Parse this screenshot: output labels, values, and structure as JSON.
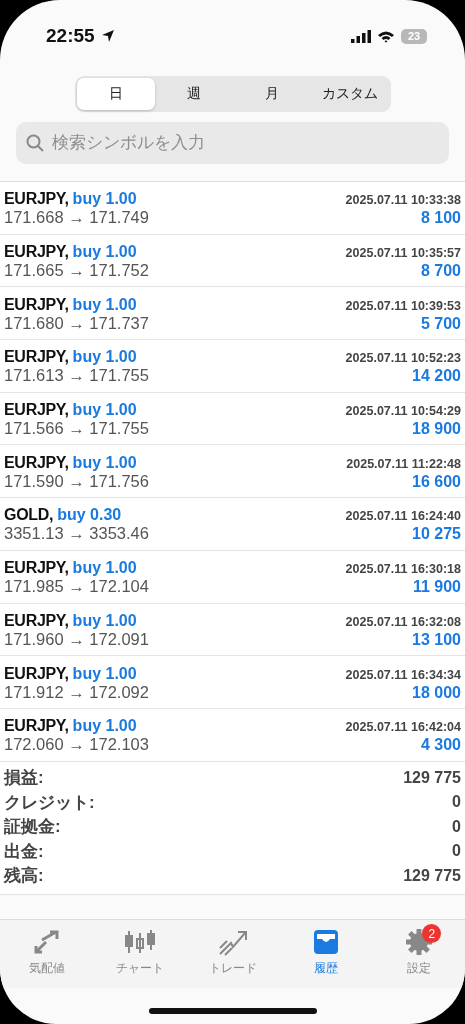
{
  "status_bar": {
    "time": "22:55",
    "battery": "23"
  },
  "period_tabs": [
    {
      "label": "日",
      "selected": true
    },
    {
      "label": "週",
      "selected": false
    },
    {
      "label": "月",
      "selected": false
    },
    {
      "label": "カスタム",
      "selected": false
    }
  ],
  "search": {
    "placeholder": "検索シンボルを入力"
  },
  "deals": [
    {
      "symbol": "EURJPY,",
      "side": "buy 1.00",
      "time": "2025.07.11 10:33:38",
      "prices": "171.668 → 171.749",
      "profit": "8 100"
    },
    {
      "symbol": "EURJPY,",
      "side": "buy 1.00",
      "time": "2025.07.11 10:35:57",
      "prices": "171.665 → 171.752",
      "profit": "8 700"
    },
    {
      "symbol": "EURJPY,",
      "side": "buy 1.00",
      "time": "2025.07.11 10:39:53",
      "prices": "171.680 → 171.737",
      "profit": "5 700"
    },
    {
      "symbol": "EURJPY,",
      "side": "buy 1.00",
      "time": "2025.07.11 10:52:23",
      "prices": "171.613 → 171.755",
      "profit": "14 200"
    },
    {
      "symbol": "EURJPY,",
      "side": "buy 1.00",
      "time": "2025.07.11 10:54:29",
      "prices": "171.566 → 171.755",
      "profit": "18 900"
    },
    {
      "symbol": "EURJPY,",
      "side": "buy 1.00",
      "time": "2025.07.11 11:22:48",
      "prices": "171.590 → 171.756",
      "profit": "16 600"
    },
    {
      "symbol": "GOLD,",
      "side": "buy 0.30",
      "time": "2025.07.11 16:24:40",
      "prices": "3351.13 → 3353.46",
      "profit": "10 275"
    },
    {
      "symbol": "EURJPY,",
      "side": "buy 1.00",
      "time": "2025.07.11 16:30:18",
      "prices": "171.985 → 172.104",
      "profit": "11 900"
    },
    {
      "symbol": "EURJPY,",
      "side": "buy 1.00",
      "time": "2025.07.11 16:32:08",
      "prices": "171.960 → 172.091",
      "profit": "13 100"
    },
    {
      "symbol": "EURJPY,",
      "side": "buy 1.00",
      "time": "2025.07.11 16:34:34",
      "prices": "171.912 → 172.092",
      "profit": "18 000"
    },
    {
      "symbol": "EURJPY,",
      "side": "buy 1.00",
      "time": "2025.07.11 16:42:04",
      "prices": "172.060 → 172.103",
      "profit": "4 300"
    }
  ],
  "summary": [
    {
      "label": "損益:",
      "value": "129 775"
    },
    {
      "label": "クレジット:",
      "value": "0"
    },
    {
      "label": "証拠金:",
      "value": "0"
    },
    {
      "label": "出金:",
      "value": "0"
    },
    {
      "label": "残高:",
      "value": "129 775"
    }
  ],
  "tab_bar": [
    {
      "kind": "quotes",
      "label": "気配値",
      "selected": false
    },
    {
      "kind": "chart",
      "label": "チャート",
      "selected": false
    },
    {
      "kind": "trade",
      "label": "トレード",
      "selected": false
    },
    {
      "kind": "history",
      "label": "履歴",
      "selected": true
    },
    {
      "kind": "settings",
      "label": "設定",
      "selected": false,
      "badge": "2"
    }
  ]
}
